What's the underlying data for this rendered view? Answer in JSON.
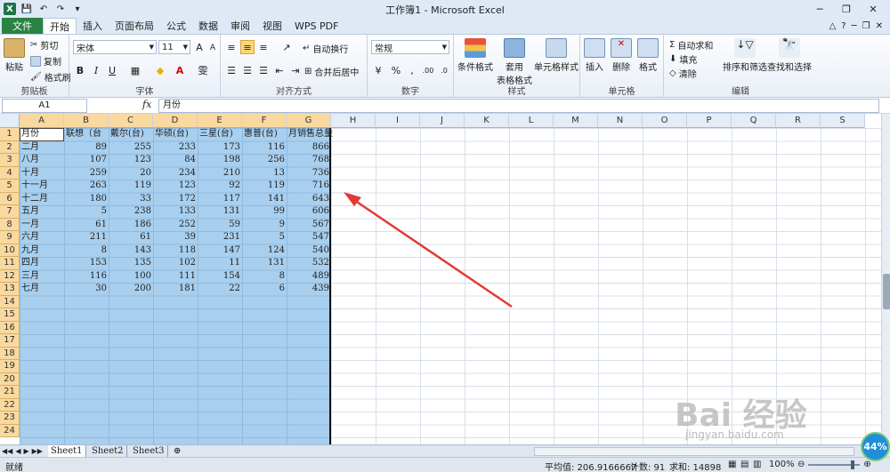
{
  "window": {
    "title": "工作簿1 - Microsoft Excel",
    "buttons": [
      "─",
      "❐",
      "✕"
    ]
  },
  "tabs": [
    "开始",
    "插入",
    "页面布局",
    "公式",
    "数据",
    "审阅",
    "视图",
    "WPS PDF"
  ],
  "file_tab": "文件",
  "active_tab": "开始",
  "ribbon": {
    "clipboard": {
      "label": "剪贴板",
      "paste": "粘贴",
      "cut": "剪切",
      "copy": "复制",
      "format_painter": "格式刷"
    },
    "font": {
      "label": "字体",
      "font_name": "宋体",
      "font_size": "11",
      "bold": "B",
      "italic": "I",
      "underline": "U",
      "special": "雯"
    },
    "alignment": {
      "label": "对齐方式",
      "wrap": "自动换行",
      "merge": "合并后居中"
    },
    "number": {
      "label": "数字",
      "format": "常规",
      "percent": "%",
      "comma": ",",
      "inc_dec": ".00"
    },
    "styles": {
      "label": "样式",
      "conditional": "条件格式",
      "table_format_1": "套用",
      "table_format_2": "表格格式",
      "cell_style": "单元格样式"
    },
    "cells": {
      "label": "单元格",
      "insert": "插入",
      "delete": "删除",
      "format": "格式"
    },
    "editing": {
      "label": "编辑",
      "autosum": "自动求和",
      "fill": "填充",
      "clear": "清除",
      "sort_filter": "排序和筛选",
      "find_select": "查找和选择"
    }
  },
  "formula_bar": {
    "name_box": "A1",
    "fx": "fx",
    "content": "月份"
  },
  "columns": [
    "A",
    "B",
    "C",
    "D",
    "E",
    "F",
    "G",
    "H",
    "I",
    "J",
    "K",
    "L",
    "M",
    "N",
    "O",
    "P",
    "Q",
    "R",
    "S"
  ],
  "rows": [
    "1",
    "2",
    "3",
    "4",
    "5",
    "6",
    "7",
    "8",
    "9",
    "10",
    "11",
    "12",
    "13",
    "14",
    "15",
    "16",
    "17",
    "18",
    "19",
    "20",
    "21",
    "22",
    "23",
    "24"
  ],
  "table": {
    "headers": [
      "月份",
      "联想（台",
      "戴尔(台)",
      "华硕(台)",
      "三星(台)",
      "惠普(台)",
      "月销售总量"
    ],
    "rows": [
      [
        "二月",
        "89",
        "255",
        "233",
        "173",
        "116",
        "866"
      ],
      [
        "八月",
        "107",
        "123",
        "84",
        "198",
        "256",
        "768"
      ],
      [
        "十月",
        "259",
        "20",
        "234",
        "210",
        "13",
        "736"
      ],
      [
        "十一月",
        "263",
        "119",
        "123",
        "92",
        "119",
        "716"
      ],
      [
        "十二月",
        "180",
        "33",
        "172",
        "117",
        "141",
        "643"
      ],
      [
        "五月",
        "5",
        "238",
        "133",
        "131",
        "99",
        "606"
      ],
      [
        "一月",
        "61",
        "186",
        "252",
        "59",
        "9",
        "567"
      ],
      [
        "六月",
        "211",
        "61",
        "39",
        "231",
        "5",
        "547"
      ],
      [
        "九月",
        "8",
        "143",
        "118",
        "147",
        "124",
        "540"
      ],
      [
        "四月",
        "153",
        "135",
        "102",
        "11",
        "131",
        "532"
      ],
      [
        "三月",
        "116",
        "100",
        "111",
        "154",
        "8",
        "489"
      ],
      [
        "七月",
        "30",
        "200",
        "181",
        "22",
        "6",
        "439"
      ]
    ]
  },
  "sheets": [
    "Sheet1",
    "Sheet2",
    "Sheet3"
  ],
  "active_sheet": "Sheet1",
  "status": {
    "mode": "就绪",
    "average": "平均值: 206.9166667",
    "count": "计数: 91",
    "sum": "求和: 14898",
    "zoom": "100%"
  },
  "badge": "44%",
  "watermark": {
    "brand": "Bai 经验",
    "url": "jingyan.baidu.com"
  },
  "colors": {
    "excel_green": "#2a8341",
    "selection": "#a8cfee",
    "header_selected": "#f9d99f",
    "arrow": "#e53935"
  }
}
